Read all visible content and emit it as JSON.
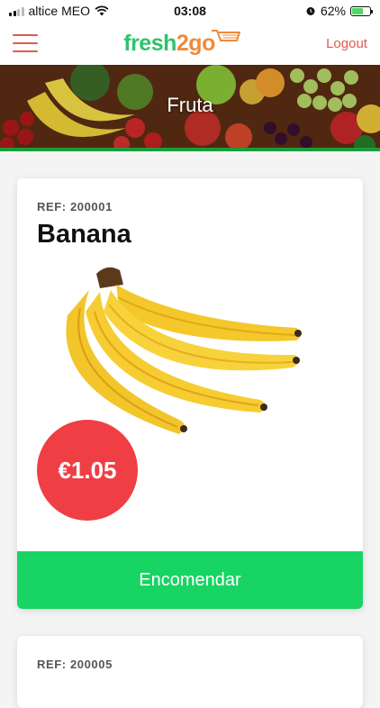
{
  "status_bar": {
    "carrier": "altice MEO",
    "time": "03:08",
    "battery": "62%",
    "battery_level": 0.62
  },
  "header": {
    "logo_part1": "fresh",
    "logo_part2": "2",
    "logo_part3": "go",
    "logout_label": "Logout"
  },
  "banner": {
    "title": "Fruta"
  },
  "products": [
    {
      "ref": "REF: 200001",
      "name": "Banana",
      "price": "€1.05",
      "order_label": "Encomendar"
    },
    {
      "ref": "REF: 200005"
    }
  ],
  "colors": {
    "accent_red": "#e05a4f",
    "price_red": "#f03e45",
    "order_green": "#17d463",
    "logo_green": "#2ec26d",
    "logo_orange": "#f08a3a"
  }
}
